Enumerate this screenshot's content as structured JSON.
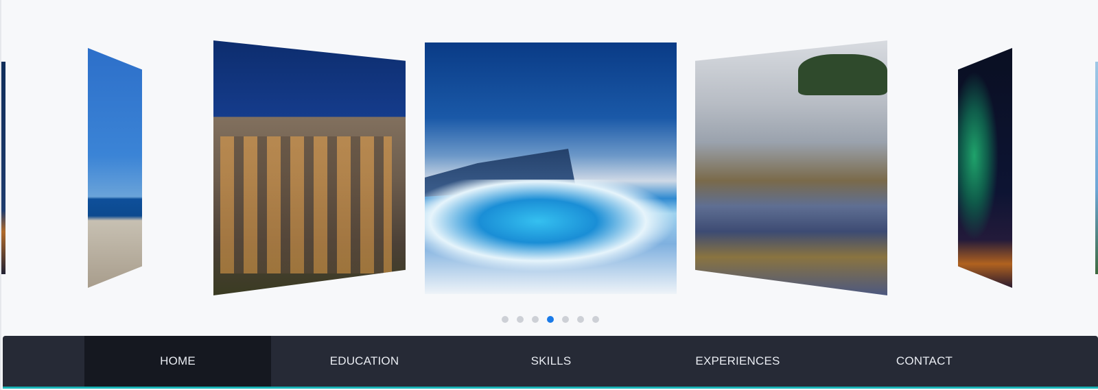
{
  "carousel": {
    "slides": [
      {
        "id": "far-left",
        "subject": "city-at-night"
      },
      {
        "id": "left-2",
        "subject": "coastal-cliff-village"
      },
      {
        "id": "left-1",
        "subject": "colosseum"
      },
      {
        "id": "center",
        "subject": "iceberg"
      },
      {
        "id": "right-1",
        "subject": "rice-terraces-in-fog"
      },
      {
        "id": "right-2",
        "subject": "aurora-over-village"
      },
      {
        "id": "far-right",
        "subject": "landscape"
      }
    ],
    "dot_count": 7,
    "active_index": 3,
    "colors": {
      "active_dot": "#1a7ae8",
      "inactive_dot": "#cdd0d6"
    }
  },
  "nav": {
    "items": [
      {
        "label": "HOME",
        "active": true
      },
      {
        "label": "EDUCATION",
        "active": false
      },
      {
        "label": "SKILLS",
        "active": false
      },
      {
        "label": "EXPERIENCES",
        "active": false
      },
      {
        "label": "CONTACT",
        "active": false
      }
    ],
    "colors": {
      "background": "#262a36",
      "active_background": "#151820",
      "accent": "#18b3b7"
    }
  }
}
